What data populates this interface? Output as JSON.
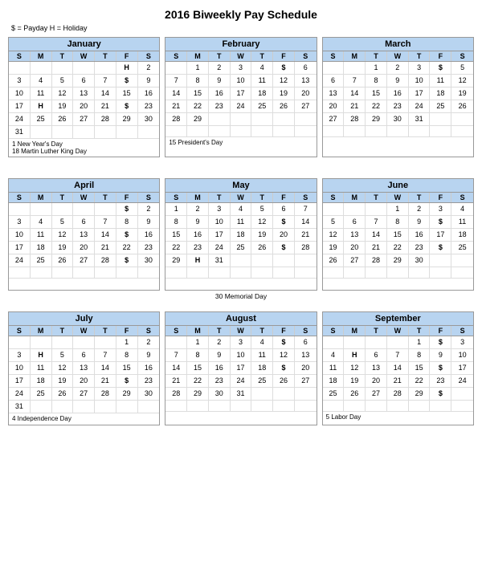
{
  "title": "2016 Biweekly Pay Schedule",
  "legend": "$ = Payday    H = Holiday",
  "months": [
    {
      "name": "January",
      "weeks": [
        [
          "",
          "",
          "",
          "",
          "",
          "H",
          "2"
        ],
        [
          "3",
          "4",
          "5",
          "6",
          "7",
          "$",
          "9"
        ],
        [
          "10",
          "11",
          "12",
          "13",
          "14",
          "15",
          "16"
        ],
        [
          "17",
          "H",
          "19",
          "20",
          "21",
          "$",
          "23"
        ],
        [
          "24",
          "25",
          "26",
          "27",
          "28",
          "29",
          "30"
        ],
        [
          "31",
          "",
          "",
          "",
          "",
          "",
          ""
        ]
      ],
      "notes": [
        "1 New Year's Day",
        "18 Martin Luther King Day"
      ]
    },
    {
      "name": "February",
      "weeks": [
        [
          "",
          "1",
          "2",
          "3",
          "4",
          "$",
          "6"
        ],
        [
          "7",
          "8",
          "9",
          "10",
          "11",
          "12",
          "13"
        ],
        [
          "14",
          "15",
          "16",
          "17",
          "18",
          "19",
          "20"
        ],
        [
          "21",
          "22",
          "23",
          "24",
          "25",
          "26",
          "27"
        ],
        [
          "28",
          "29",
          "",
          "",
          "",
          "",
          ""
        ],
        [
          "",
          "",
          "",
          "",
          "",
          "",
          ""
        ]
      ],
      "notes": [
        "15 President's Day"
      ]
    },
    {
      "name": "March",
      "weeks": [
        [
          "",
          "",
          "1",
          "2",
          "3",
          "$",
          "5"
        ],
        [
          "6",
          "7",
          "8",
          "9",
          "10",
          "11",
          "12"
        ],
        [
          "13",
          "14",
          "15",
          "16",
          "17",
          "18",
          "19"
        ],
        [
          "20",
          "21",
          "22",
          "23",
          "24",
          "25",
          "26"
        ],
        [
          "27",
          "28",
          "29",
          "30",
          "31",
          "",
          ""
        ],
        [
          "",
          "",
          "",
          "",
          "",
          "",
          ""
        ]
      ],
      "notes": []
    },
    {
      "name": "April",
      "weeks": [
        [
          "",
          "",
          "",
          "",
          "",
          "$",
          "2"
        ],
        [
          "3",
          "4",
          "5",
          "6",
          "7",
          "8",
          "9"
        ],
        [
          "10",
          "11",
          "12",
          "13",
          "14",
          "$",
          "16"
        ],
        [
          "17",
          "18",
          "19",
          "20",
          "21",
          "22",
          "23"
        ],
        [
          "24",
          "25",
          "26",
          "27",
          "28",
          "$",
          "30"
        ],
        [
          "",
          "",
          "",
          "",
          "",
          "",
          ""
        ]
      ],
      "notes": []
    },
    {
      "name": "May",
      "weeks": [
        [
          "1",
          "2",
          "3",
          "4",
          "5",
          "6",
          "7"
        ],
        [
          "8",
          "9",
          "10",
          "11",
          "12",
          "$",
          "14"
        ],
        [
          "15",
          "16",
          "17",
          "18",
          "19",
          "20",
          "21"
        ],
        [
          "22",
          "23",
          "24",
          "25",
          "26",
          "$",
          "28"
        ],
        [
          "29",
          "H",
          "31",
          "",
          "",
          "",
          ""
        ],
        [
          "",
          "",
          "",
          "",
          "",
          "",
          ""
        ]
      ],
      "notes": []
    },
    {
      "name": "June",
      "weeks": [
        [
          "",
          "",
          "",
          "1",
          "2",
          "3",
          "4"
        ],
        [
          "5",
          "6",
          "7",
          "8",
          "9",
          "$",
          "11"
        ],
        [
          "12",
          "13",
          "14",
          "15",
          "16",
          "17",
          "18"
        ],
        [
          "19",
          "20",
          "21",
          "22",
          "23",
          "$",
          "25"
        ],
        [
          "26",
          "27",
          "28",
          "29",
          "30",
          "",
          ""
        ],
        [
          "",
          "",
          "",
          "",
          "",
          "",
          ""
        ]
      ],
      "notes": []
    },
    {
      "name": "July",
      "weeks": [
        [
          "",
          "",
          "",
          "",
          "",
          "1",
          "2"
        ],
        [
          "3",
          "H",
          "5",
          "6",
          "7",
          "8",
          "9"
        ],
        [
          "10",
          "11",
          "12",
          "13",
          "14",
          "15",
          "16"
        ],
        [
          "17",
          "18",
          "19",
          "20",
          "21",
          "$",
          "23"
        ],
        [
          "24",
          "25",
          "26",
          "27",
          "28",
          "29",
          "30"
        ],
        [
          "31",
          "",
          "",
          "",
          "",
          "",
          ""
        ]
      ],
      "notes": [
        "4 Independence Day"
      ]
    },
    {
      "name": "August",
      "weeks": [
        [
          "",
          "1",
          "2",
          "3",
          "4",
          "$",
          "6"
        ],
        [
          "7",
          "8",
          "9",
          "10",
          "11",
          "12",
          "13"
        ],
        [
          "14",
          "15",
          "16",
          "17",
          "18",
          "$",
          "20"
        ],
        [
          "21",
          "22",
          "23",
          "24",
          "25",
          "26",
          "27"
        ],
        [
          "28",
          "29",
          "30",
          "31",
          "",
          "",
          ""
        ],
        [
          "",
          "",
          "",
          "",
          "",
          "",
          ""
        ]
      ],
      "notes": []
    },
    {
      "name": "September",
      "weeks": [
        [
          "",
          "",
          "",
          "",
          "1",
          "$",
          "3"
        ],
        [
          "4",
          "H",
          "6",
          "7",
          "8",
          "9",
          "10"
        ],
        [
          "11",
          "12",
          "13",
          "14",
          "15",
          "$",
          "17"
        ],
        [
          "18",
          "19",
          "20",
          "21",
          "22",
          "23",
          "24"
        ],
        [
          "25",
          "26",
          "27",
          "28",
          "29",
          "$",
          ""
        ],
        [
          "",
          "",
          "",
          "",
          "",
          "",
          ""
        ]
      ],
      "notes": [
        "5 Labor Day"
      ]
    }
  ],
  "section_notes": {
    "row1": "30  Memorial Day",
    "row2": ""
  },
  "days_header": [
    "S",
    "M",
    "T",
    "W",
    "T",
    "F",
    "S"
  ]
}
